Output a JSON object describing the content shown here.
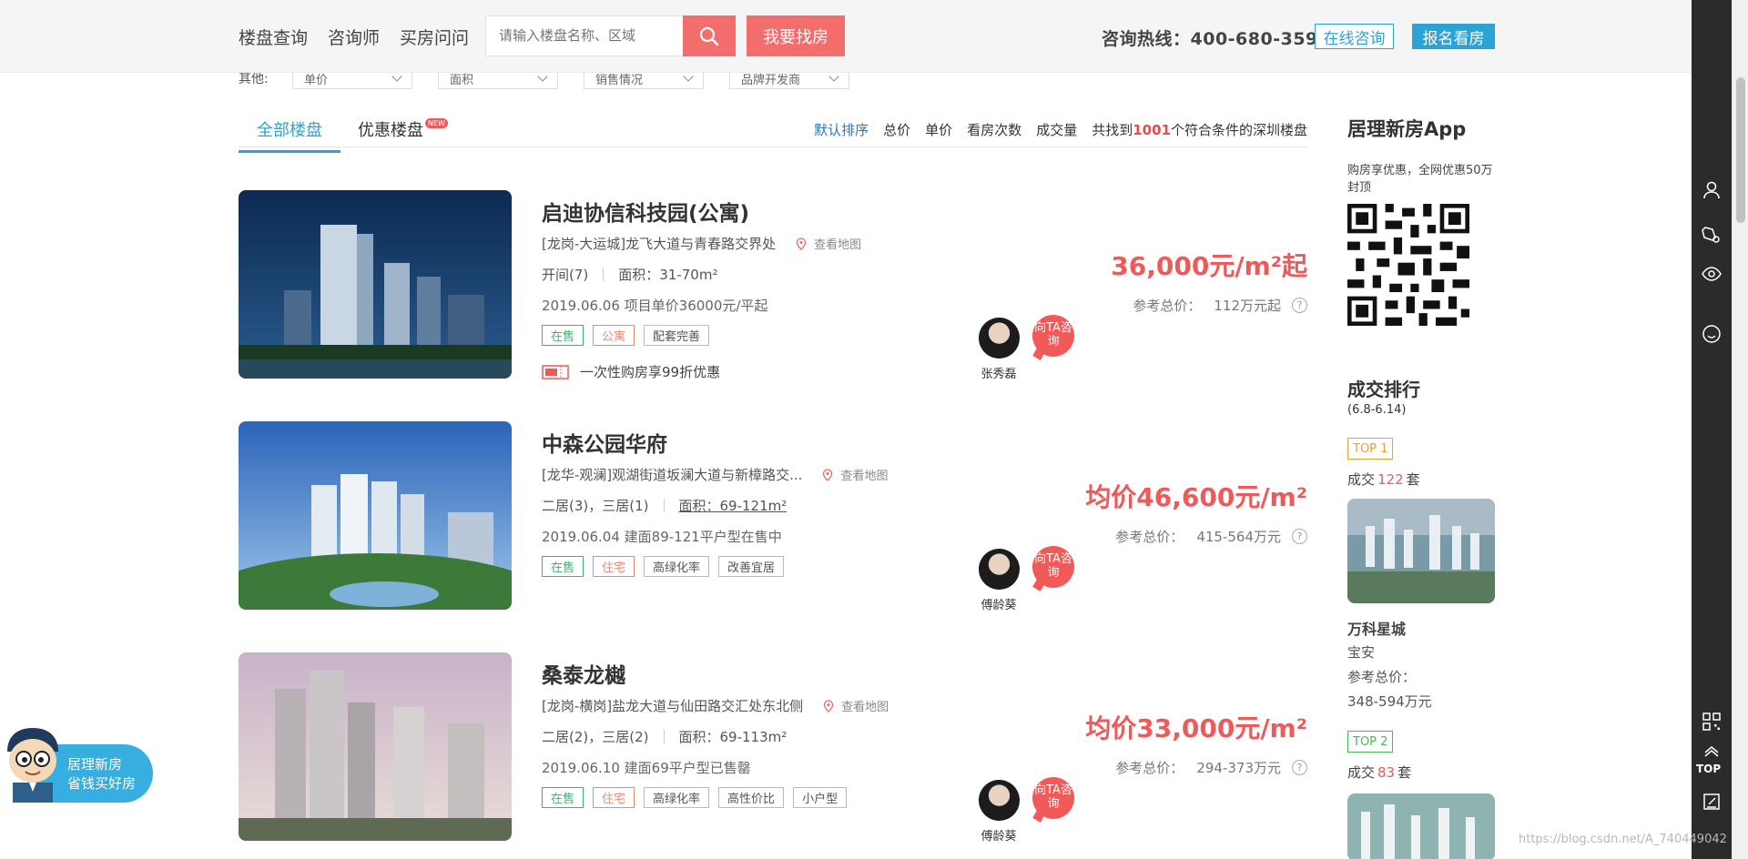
{
  "header": {
    "nav": [
      "楼盘查询",
      "咨询师",
      "买房问问"
    ],
    "search_placeholder": "请输入楼盘名称、区域",
    "find_button": "我要找房",
    "hotline_label": "咨询热线：",
    "hotline_number": "400-680-3598",
    "online_button": "在线咨询",
    "visit_button": "报名看房"
  },
  "filters": {
    "label": "其他:",
    "dropdowns": [
      "单价",
      "面积",
      "销售情况",
      "品牌开发商"
    ]
  },
  "tabs": {
    "all": "全部楼盘",
    "discount": "优惠楼盘",
    "new_badge": "NEW",
    "sorts": [
      "默认排序",
      "总价",
      "单价",
      "看房次数",
      "成交量"
    ],
    "count_prefix": "共找到",
    "count": "1001",
    "count_suffix": "个符合条件的深圳楼盘"
  },
  "listings": [
    {
      "title": "启迪协信科技园(公寓)",
      "address": "[龙岗-大运城]龙飞大道与青春路交界处",
      "map_link": "查看地图",
      "spec_left": "开间(7)",
      "spec_right": "面积：31-70m²",
      "info": "2019.06.06 项目单价36000元/平起",
      "tags": [
        "在售",
        "公寓",
        "配套完善"
      ],
      "promo": "一次性购房享99折优惠",
      "agent_name": "张秀磊",
      "ask": "向TA咨询",
      "price": "36,000元/m²起",
      "total_label": "参考总价：",
      "total": "112万元起"
    },
    {
      "title": "中森公园华府",
      "address": "[龙华-观澜]观湖街道坂澜大道与新樟路交...",
      "map_link": "查看地图",
      "spec_left": "二居(3)，三居(1)",
      "spec_right": "面积：69-121m²",
      "info": "2019.06.04 建面89-121平户型在售中",
      "tags": [
        "在售",
        "住宅",
        "高绿化率",
        "改善宜居"
      ],
      "agent_name": "傅龄葵",
      "ask": "向TA咨询",
      "price": "均价46,600元/m²",
      "total_label": "参考总价：",
      "total": "415-564万元"
    },
    {
      "title": "桑泰龙樾",
      "address": "[龙岗-横岗]盐龙大道与仙田路交汇处东北侧",
      "map_link": "查看地图",
      "spec_left": "二居(2)，三居(2)",
      "spec_right": "面积：69-113m²",
      "info": "2019.06.10 建面69平户型已售罄",
      "tags": [
        "在售",
        "住宅",
        "高绿化率",
        "高性价比",
        "小户型"
      ],
      "agent_name": "傅龄葵",
      "ask": "向TA咨询",
      "price": "均价33,000元/m²",
      "total_label": "参考总价：",
      "total": "294-373万元"
    }
  ],
  "sidebar": {
    "app_title": "居理新房App",
    "app_sub": "购房享优惠，全网优惠50万封顶",
    "rank_title": "成交排行",
    "rank_date": "(6.8-6.14)",
    "top1": "TOP 1",
    "top1_deal_prefix": "成交",
    "top1_deal_count": "122",
    "top1_deal_suffix": "套",
    "top1_name": "万科星城",
    "top1_area": "宝安",
    "top1_ref_label": "参考总价：",
    "top1_price": "348-594万元",
    "top2": "TOP 2",
    "top2_deal_prefix": "成交",
    "top2_deal_count": "83",
    "top2_deal_suffix": "套"
  },
  "rail": {
    "top_label": "TOP"
  },
  "float_banner": {
    "line1": "居理新房",
    "line2": "省钱买好房"
  },
  "watermark": "https://blog.csdn.net/A_740449042"
}
